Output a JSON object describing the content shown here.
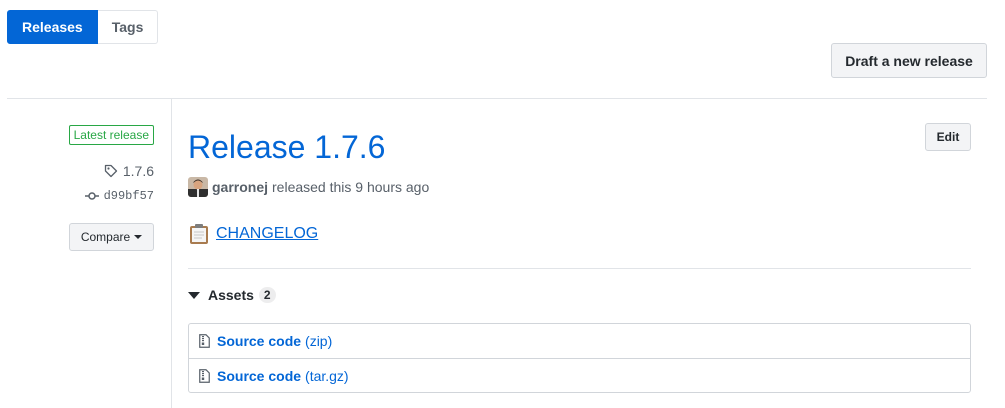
{
  "subnav": {
    "items": [
      {
        "label": "Releases",
        "selected": true
      },
      {
        "label": "Tags",
        "selected": false
      }
    ]
  },
  "header": {
    "draft_button": "Draft a new release"
  },
  "sidebar": {
    "latest_label": "Latest release",
    "tag": "1.7.6",
    "commit": "d99bf57",
    "compare_button": "Compare"
  },
  "release": {
    "title": "Release 1.7.6",
    "edit_button": "Edit",
    "author": "garronej",
    "released_text": "released this 9 hours ago",
    "changelog_icon": "clipboard-emoji",
    "changelog_link": "CHANGELOG"
  },
  "assets": {
    "heading": "Assets",
    "count": "2",
    "items": [
      {
        "name": "Source code",
        "ext": "(zip)",
        "icon": "file-zip-icon"
      },
      {
        "name": "Source code",
        "ext": "(tar.gz)",
        "icon": "file-zip-icon"
      }
    ]
  },
  "colors": {
    "accent": "#0366d6",
    "latest_green": "#28a745",
    "border": "#e1e4e8"
  }
}
